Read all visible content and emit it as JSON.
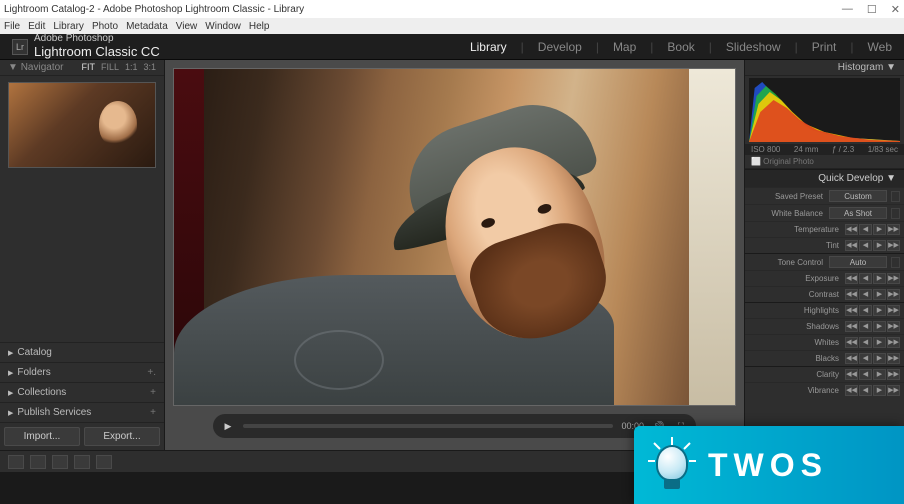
{
  "window": {
    "title": "Lightroom Catalog-2 - Adobe Photoshop Lightroom Classic - Library"
  },
  "menubar": [
    "File",
    "Edit",
    "Library",
    "Photo",
    "Metadata",
    "View",
    "Window",
    "Help"
  ],
  "brand": {
    "badge": "Lr",
    "line1": "Adobe Photoshop",
    "line2": "Lightroom Classic CC"
  },
  "modules": [
    "Library",
    "Develop",
    "Map",
    "Book",
    "Slideshow",
    "Print",
    "Web"
  ],
  "active_module": "Library",
  "navigator": {
    "label": "Navigator",
    "opts": [
      "FIT",
      "FILL",
      "1:1",
      "3:1"
    ]
  },
  "left_panels": [
    {
      "label": "Catalog",
      "plus": false
    },
    {
      "label": "Folders",
      "plus": true
    },
    {
      "label": "Collections",
      "plus": true
    },
    {
      "label": "Publish Services",
      "plus": true
    }
  ],
  "buttons": {
    "import": "Import...",
    "export": "Export..."
  },
  "playbar": {
    "play": "▶",
    "time": "00:00",
    "vol": "🔊",
    "full": "⛶"
  },
  "histogram": {
    "label": "Histogram  ▼",
    "meta": {
      "iso": "ISO 800",
      "focal": "24 mm",
      "aperture": "ƒ / 2.3",
      "shutter": "1/83 sec"
    },
    "original": "⬜ Original Photo"
  },
  "quick_develop": {
    "label": "Quick Develop  ▼",
    "saved_preset": {
      "label": "Saved Preset",
      "value": "Custom"
    },
    "white_balance": {
      "label": "White Balance",
      "value": "As Shot"
    },
    "rows1": [
      {
        "label": "Temperature"
      },
      {
        "label": "Tint"
      }
    ],
    "tone_label": "Tone Control",
    "tone_value": "Auto",
    "rows2": [
      {
        "label": "Exposure"
      },
      {
        "label": "Contrast"
      }
    ],
    "rows3": [
      {
        "label": "Highlights"
      },
      {
        "label": "Shadows"
      },
      {
        "label": "Whites"
      },
      {
        "label": "Blacks"
      }
    ],
    "rows4": [
      {
        "label": "Clarity"
      },
      {
        "label": "Vibrance"
      }
    ]
  },
  "overlay": {
    "text": "TWOS"
  }
}
